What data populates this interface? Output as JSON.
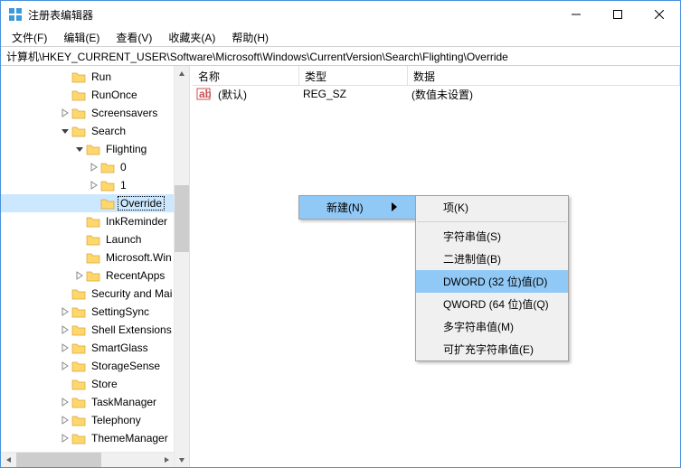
{
  "window": {
    "title": "注册表编辑器"
  },
  "menubar": {
    "file": "文件(F)",
    "edit": "编辑(E)",
    "view": "查看(V)",
    "favorites": "收藏夹(A)",
    "help": "帮助(H)"
  },
  "addressbar": {
    "path": "计算机\\HKEY_CURRENT_USER\\Software\\Microsoft\\Windows\\CurrentVersion\\Search\\Flighting\\Override"
  },
  "tree": [
    {
      "depth": 4,
      "expander": "none",
      "label": "Run"
    },
    {
      "depth": 4,
      "expander": "none",
      "label": "RunOnce"
    },
    {
      "depth": 4,
      "expander": "close",
      "label": "Screensavers"
    },
    {
      "depth": 4,
      "expander": "open",
      "label": "Search"
    },
    {
      "depth": 5,
      "expander": "open",
      "label": "Flighting"
    },
    {
      "depth": 6,
      "expander": "close",
      "label": "0"
    },
    {
      "depth": 6,
      "expander": "close",
      "label": "1"
    },
    {
      "depth": 6,
      "expander": "none",
      "label": "Override",
      "selected": true
    },
    {
      "depth": 5,
      "expander": "none",
      "label": "InkReminder"
    },
    {
      "depth": 5,
      "expander": "none",
      "label": "Launch"
    },
    {
      "depth": 5,
      "expander": "none",
      "label": "Microsoft.Win"
    },
    {
      "depth": 5,
      "expander": "close",
      "label": "RecentApps"
    },
    {
      "depth": 4,
      "expander": "none",
      "label": "Security and Mai"
    },
    {
      "depth": 4,
      "expander": "close",
      "label": "SettingSync"
    },
    {
      "depth": 4,
      "expander": "close",
      "label": "Shell Extensions"
    },
    {
      "depth": 4,
      "expander": "close",
      "label": "SmartGlass"
    },
    {
      "depth": 4,
      "expander": "close",
      "label": "StorageSense"
    },
    {
      "depth": 4,
      "expander": "none",
      "label": "Store"
    },
    {
      "depth": 4,
      "expander": "close",
      "label": "TaskManager"
    },
    {
      "depth": 4,
      "expander": "close",
      "label": "Telephony"
    },
    {
      "depth": 4,
      "expander": "close",
      "label": "ThemeManager"
    }
  ],
  "list": {
    "header": {
      "name": "名称",
      "type": "类型",
      "data": "数据"
    },
    "rows": [
      {
        "name": "(默认)",
        "type": "REG_SZ",
        "data": "(数值未设置)"
      }
    ]
  },
  "context_menu_parent": {
    "new": "新建(N)"
  },
  "context_menu_new": {
    "key": "项(K)",
    "string": "字符串值(S)",
    "binary": "二进制值(B)",
    "dword": "DWORD (32 位)值(D)",
    "qword": "QWORD (64 位)值(Q)",
    "multi_string": "多字符串值(M)",
    "expand_string": "可扩充字符串值(E)"
  }
}
